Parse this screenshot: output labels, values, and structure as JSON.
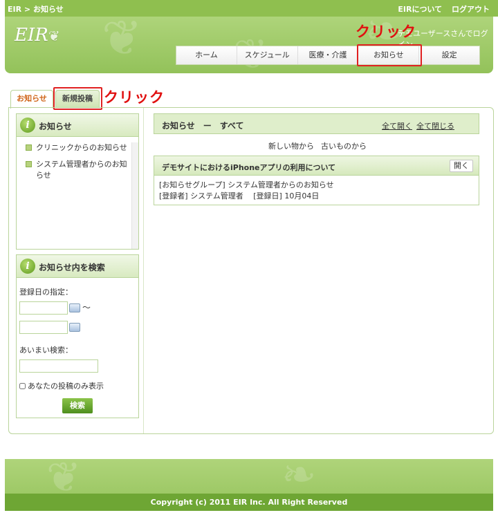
{
  "topbar": {
    "breadcrumb": "EIR > お知らせ",
    "about": "EIRについて",
    "logout": "ログアウト"
  },
  "header": {
    "logo": "EIR",
    "welcome": "デモユーザースさんでログイン"
  },
  "nav": {
    "items": [
      "ホーム",
      "スケジュール",
      "医療・介護",
      "お知らせ",
      "設定"
    ]
  },
  "annotations": {
    "click1": "クリック",
    "click2": "クリック"
  },
  "tabs": {
    "active": "お知らせ",
    "new_post": "新規投稿"
  },
  "sidebar": {
    "notices": {
      "title": "お知らせ",
      "items": [
        "クリニックからのお知らせ",
        "システム管理者からのお知らせ"
      ]
    },
    "search": {
      "title": "お知らせ内を検索",
      "date_label": "登録日の指定：",
      "tilde": "〜",
      "fuzzy_label": "あいまい検索：",
      "own_only": "あなたの投稿のみ表示",
      "button": "検索"
    }
  },
  "main": {
    "header": "お知らせ　ー　すべて",
    "expand_all": "全て開く",
    "collapse_all": "全て閉じる",
    "sort_new": "新しい物から",
    "sort_old": "古いものから",
    "notice": {
      "title": "デモサイトにおけるiPhoneアプリの利用について",
      "open": "開く",
      "group": "[お知らせグループ] システム管理者からのお知らせ",
      "meta": "[登録者]  システム管理者　 [登録日]  10月04日"
    }
  },
  "footer": {
    "copyright": "Copyright (c) 2011 EIR Inc. All Right Reserved"
  },
  "colors": {
    "brand_green": "#8fbf4f",
    "accent_orange": "#d0651a",
    "annotation_red": "#e01010"
  }
}
